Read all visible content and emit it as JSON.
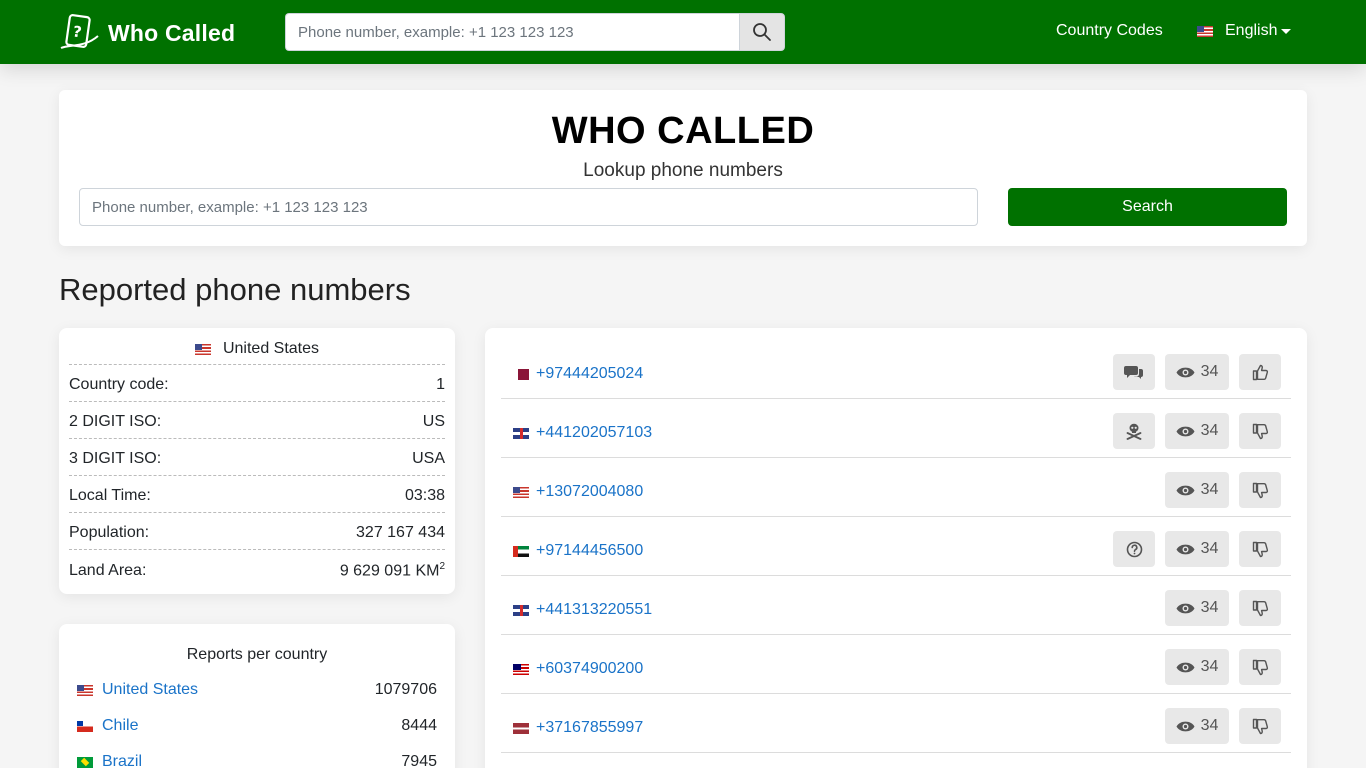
{
  "navbar": {
    "brand": "Who Called",
    "search_placeholder": "Phone number, example: +1 123 123 123",
    "country_codes": "Country Codes",
    "language": "English"
  },
  "hero": {
    "title": "WHO CALLED",
    "subtitle": "Lookup phone numbers",
    "placeholder": "Phone number, example: +1 123 123 123",
    "button": "Search"
  },
  "section_title": "Reported phone numbers",
  "country_info": {
    "country": "United States",
    "rows": [
      {
        "label": "Country code:",
        "value": "1"
      },
      {
        "label": "2 DIGIT ISO:",
        "value": "US"
      },
      {
        "label": "3 DIGIT ISO:",
        "value": "USA"
      },
      {
        "label": "Local Time:",
        "value": "03:38"
      },
      {
        "label": "Population:",
        "value": "327 167 434"
      },
      {
        "label": "Land Area:",
        "value": "9 629 091 KM",
        "sup": "2"
      }
    ]
  },
  "reports": {
    "title": "Reports per country",
    "rows": [
      {
        "country": "United States",
        "count": "1079706",
        "flag": "us"
      },
      {
        "country": "Chile",
        "count": "8444",
        "flag": "cl"
      },
      {
        "country": "Brazil",
        "count": "7945",
        "flag": "br"
      }
    ]
  },
  "phones": [
    {
      "number": "+97444205024",
      "flag": "qa",
      "tag": "chat-icon",
      "views": "34",
      "vote": "thumbs-up-icon"
    },
    {
      "number": "+441202057103",
      "flag": "gb",
      "tag": "skull-icon",
      "views": "34",
      "vote": "thumbs-down-icon"
    },
    {
      "number": "+13072004080",
      "flag": "us",
      "tag": "",
      "views": "34",
      "vote": "thumbs-down-icon"
    },
    {
      "number": "+97144456500",
      "flag": "ae",
      "tag": "question-icon",
      "views": "34",
      "vote": "thumbs-down-icon"
    },
    {
      "number": "+441313220551",
      "flag": "gb",
      "tag": "",
      "views": "34",
      "vote": "thumbs-down-icon"
    },
    {
      "number": "+60374900200",
      "flag": "my",
      "tag": "",
      "views": "34",
      "vote": "thumbs-down-icon"
    },
    {
      "number": "+37167855997",
      "flag": "lv",
      "tag": "",
      "views": "34",
      "vote": "thumbs-down-icon"
    }
  ],
  "colors": {
    "brand_green": "#007100",
    "link_blue": "#1a73c8"
  }
}
